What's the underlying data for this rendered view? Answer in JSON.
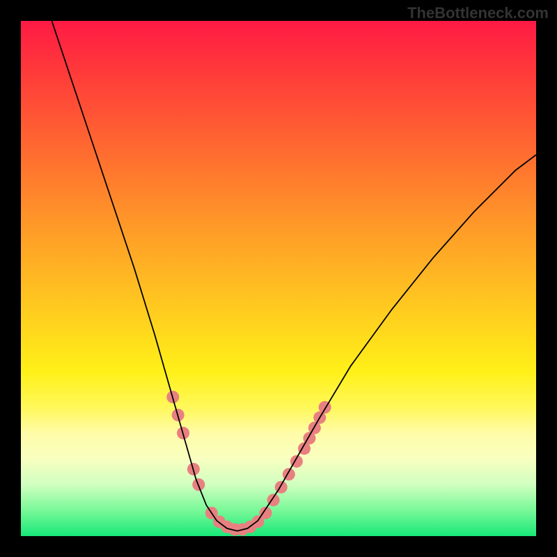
{
  "watermark": "TheBottleneck.com",
  "chart_data": {
    "type": "line",
    "title": "",
    "xlabel": "",
    "ylabel": "",
    "xlim": [
      0,
      100
    ],
    "ylim": [
      0,
      100
    ],
    "gradient_stops": [
      {
        "pos": 0,
        "color": "#ff1a44"
      },
      {
        "pos": 10,
        "color": "#ff3a3a"
      },
      {
        "pos": 25,
        "color": "#ff6a30"
      },
      {
        "pos": 40,
        "color": "#ff9a28"
      },
      {
        "pos": 55,
        "color": "#ffc820"
      },
      {
        "pos": 68,
        "color": "#fff018"
      },
      {
        "pos": 75,
        "color": "#fff85a"
      },
      {
        "pos": 80,
        "color": "#fffca8"
      },
      {
        "pos": 85,
        "color": "#f8ffc0"
      },
      {
        "pos": 90,
        "color": "#d0ffc0"
      },
      {
        "pos": 95,
        "color": "#78f898"
      },
      {
        "pos": 100,
        "color": "#18e878"
      }
    ],
    "series": [
      {
        "name": "bottleneck-curve",
        "color": "#000000",
        "points": [
          {
            "x": 6,
            "y": 100
          },
          {
            "x": 10,
            "y": 88
          },
          {
            "x": 14,
            "y": 76
          },
          {
            "x": 18,
            "y": 64
          },
          {
            "x": 22,
            "y": 52
          },
          {
            "x": 26,
            "y": 39
          },
          {
            "x": 28,
            "y": 32
          },
          {
            "x": 30,
            "y": 25
          },
          {
            "x": 32,
            "y": 18
          },
          {
            "x": 34,
            "y": 11
          },
          {
            "x": 36,
            "y": 6
          },
          {
            "x": 38,
            "y": 3
          },
          {
            "x": 40,
            "y": 1.5
          },
          {
            "x": 42,
            "y": 1
          },
          {
            "x": 44,
            "y": 1.5
          },
          {
            "x": 46,
            "y": 3
          },
          {
            "x": 48,
            "y": 6
          },
          {
            "x": 50,
            "y": 9
          },
          {
            "x": 54,
            "y": 16
          },
          {
            "x": 58,
            "y": 23
          },
          {
            "x": 64,
            "y": 33
          },
          {
            "x": 72,
            "y": 44
          },
          {
            "x": 80,
            "y": 54
          },
          {
            "x": 88,
            "y": 63
          },
          {
            "x": 96,
            "y": 71
          },
          {
            "x": 100,
            "y": 74
          }
        ]
      }
    ],
    "markers": {
      "name": "highlight-dots",
      "color": "#e88080",
      "radius": 9,
      "points": [
        {
          "x": 29.5,
          "y": 27
        },
        {
          "x": 30.5,
          "y": 23.5
        },
        {
          "x": 31.5,
          "y": 20
        },
        {
          "x": 33.5,
          "y": 13
        },
        {
          "x": 34.5,
          "y": 10
        },
        {
          "x": 37,
          "y": 4.5
        },
        {
          "x": 38.5,
          "y": 2.8
        },
        {
          "x": 40,
          "y": 1.8
        },
        {
          "x": 41.5,
          "y": 1.3
        },
        {
          "x": 43,
          "y": 1.3
        },
        {
          "x": 44.5,
          "y": 1.8
        },
        {
          "x": 46,
          "y": 2.8
        },
        {
          "x": 47.5,
          "y": 4.5
        },
        {
          "x": 49,
          "y": 7
        },
        {
          "x": 50.5,
          "y": 9.5
        },
        {
          "x": 52,
          "y": 12
        },
        {
          "x": 53.5,
          "y": 14.5
        },
        {
          "x": 55,
          "y": 17
        },
        {
          "x": 56,
          "y": 19
        },
        {
          "x": 57,
          "y": 21
        },
        {
          "x": 58,
          "y": 23
        },
        {
          "x": 59,
          "y": 25
        }
      ]
    }
  }
}
